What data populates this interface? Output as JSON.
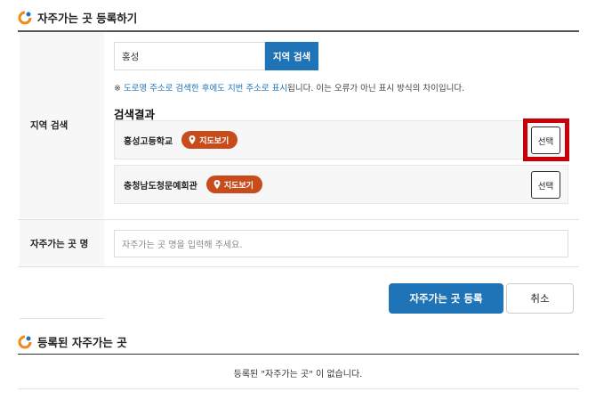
{
  "register_section": {
    "title": "자주가는 곳 등록하기",
    "region_label": "지역 검색",
    "search": {
      "value": "홍성",
      "button_label": "지역 검색"
    },
    "notice": {
      "prefix": "※ ",
      "highlight": "도로명 주소로 검색한 후에도 지번 주소로 표시",
      "suffix": "됩니다. 이는 오류가 아닌 표시 방식의 차이입니다."
    },
    "results_title": "검색결과",
    "results": [
      {
        "name": "홍성고등학교",
        "map_label": "지도보기",
        "select_label": "선택"
      },
      {
        "name": "충청남도청문예회관",
        "map_label": "지도보기",
        "select_label": "선택"
      }
    ],
    "place_name_label": "자주가는 곳 명",
    "place_name_placeholder": "자주가는 곳 명을 입력해 주세요.",
    "register_button": "자주가는 곳 등록",
    "cancel_button": "취소"
  },
  "registered_section": {
    "title": "등록된 자주가는 곳",
    "empty_message": "등록된 \"자주가는 곳\" 이 없습니다."
  },
  "colors": {
    "accent_blue": "#1f73b7",
    "map_button": "#c84b1c",
    "highlight_box": "#c8000a",
    "icon_orange": "#f08a1c"
  }
}
